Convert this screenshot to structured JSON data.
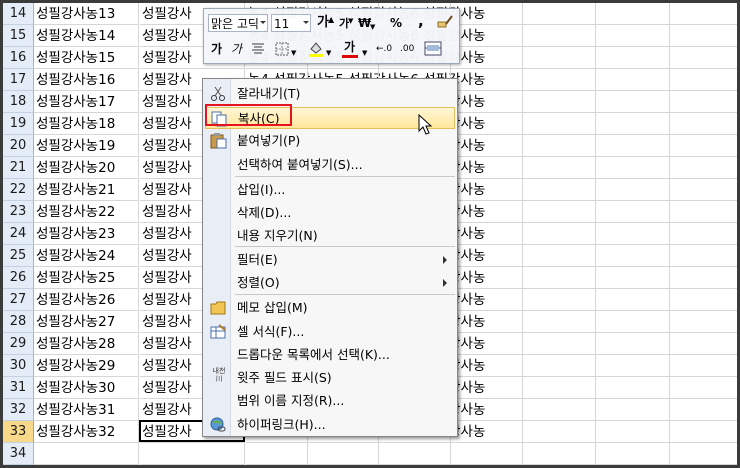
{
  "sheet": {
    "rows": [
      {
        "num": "14",
        "a": "성필강사농13",
        "b": "성필강사",
        "right": "농4 성필강사농5 성필강사농6 성필강사농"
      },
      {
        "num": "15",
        "a": "성필강사농14",
        "b": "성필강사",
        "right": "농4 성필강사농5 성필강사농6 성필강사농"
      },
      {
        "num": "16",
        "a": "성필강사농15",
        "b": "성필강사",
        "right": "농4 성필강사농5 성필강사농6 성필강사농"
      },
      {
        "num": "17",
        "a": "성필강사농16",
        "b": "성필강사",
        "right": "농4 성필강사농5 성필강사농6 성필강사농"
      },
      {
        "num": "18",
        "a": "성필강사농17",
        "b": "성필강사",
        "right": "농4 성필강사농5 성필강사농6 성필강사농"
      },
      {
        "num": "19",
        "a": "성필강사농18",
        "b": "성필강사",
        "right": "농4 성필강사농5 성필강사농6 성필강사농"
      },
      {
        "num": "20",
        "a": "성필강사농19",
        "b": "성필강사",
        "right": "농4 성필강사농5 성필강사농6 성필강사농"
      },
      {
        "num": "21",
        "a": "성필강사농20",
        "b": "성필강사",
        "right": "농4 성필강사농5 성필강사농6 성필강사농"
      },
      {
        "num": "22",
        "a": "성필강사농21",
        "b": "성필강사",
        "right": "농4 성필강사농5 성필강사농6 성필강사농"
      },
      {
        "num": "23",
        "a": "성필강사농22",
        "b": "성필강사",
        "right": "농4 성필강사농5 성필강사농6 성필강사농"
      },
      {
        "num": "24",
        "a": "성필강사농23",
        "b": "성필강사",
        "right": "농4 성필강사농5 성필강사농6 성필강사농"
      },
      {
        "num": "25",
        "a": "성필강사농24",
        "b": "성필강사",
        "right": "농4 성필강사농5 성필강사농6 성필강사농"
      },
      {
        "num": "26",
        "a": "성필강사농25",
        "b": "성필강사",
        "right": "농4 성필강사농5 성필강사농6 성필강사농"
      },
      {
        "num": "27",
        "a": "성필강사농26",
        "b": "성필강사",
        "right": "농4 성필강사농5 성필강사농6 성필강사농"
      },
      {
        "num": "28",
        "a": "성필강사농27",
        "b": "성필강사",
        "right": "농4 성필강사농5 성필강사농6 성필강사농"
      },
      {
        "num": "29",
        "a": "성필강사농28",
        "b": "성필강사",
        "right": "농4 성필강사농5 성필강사농6 성필강사농"
      },
      {
        "num": "30",
        "a": "성필강사농29",
        "b": "성필강사",
        "right": "농4 성필강사농5 성필강사농6 성필강사농"
      },
      {
        "num": "31",
        "a": "성필강사농30",
        "b": "성필강사",
        "right": "농4 성필강사농5 성필강사농6 성필강사농"
      },
      {
        "num": "32",
        "a": "성필강사농31",
        "b": "성필강사",
        "right": "농4 성필강사농5 성필강사농6 성필강사농"
      },
      {
        "num": "33",
        "a": "성필강사농32",
        "b": "성필강사",
        "right": "농4 성필강사농5 성필강사농6 성필강사농"
      },
      {
        "num": "34",
        "a": "",
        "b": "",
        "right": ""
      }
    ]
  },
  "mini_toolbar": {
    "font_name": "맑은 고딕",
    "font_size": "11",
    "grow_font": "가",
    "shrink_font": "가",
    "currency": "₩",
    "percent": "%",
    "comma": ",",
    "bold": "가",
    "italic": "가",
    "font_color": "가"
  },
  "context_menu": {
    "items": [
      {
        "label": "잘라내기(T)",
        "icon": "scissors-icon"
      },
      {
        "label": "복사(C)",
        "icon": "copy-icon"
      },
      {
        "label": "붙여넣기(P)",
        "icon": "paste-icon"
      },
      {
        "label": "선택하여 붙여넣기(S)...",
        "icon": ""
      },
      {
        "label": "삽입(I)...",
        "icon": ""
      },
      {
        "label": "삭제(D)...",
        "icon": ""
      },
      {
        "label": "내용 지우기(N)",
        "icon": ""
      },
      {
        "label": "필터(E)",
        "icon": ""
      },
      {
        "label": "정렬(O)",
        "icon": ""
      },
      {
        "label": "메모 삽입(M)",
        "icon": "comment-icon"
      },
      {
        "label": "셀 서식(F)...",
        "icon": "format-cells-icon"
      },
      {
        "label": "드롭다운 목록에서 선택(K)...",
        "icon": ""
      },
      {
        "label": "윗주 필드 표시(S)",
        "icon": "phonetic-icon"
      },
      {
        "label": "범위 이름 지정(R)...",
        "icon": ""
      },
      {
        "label": "하이퍼링크(H)...",
        "icon": "hyperlink-icon"
      }
    ],
    "phonetic_icon_text": "내천",
    "phonetic_icon_subtext": "川",
    "highlighted": "복사(C)",
    "highlight_color": "#e5141e"
  }
}
